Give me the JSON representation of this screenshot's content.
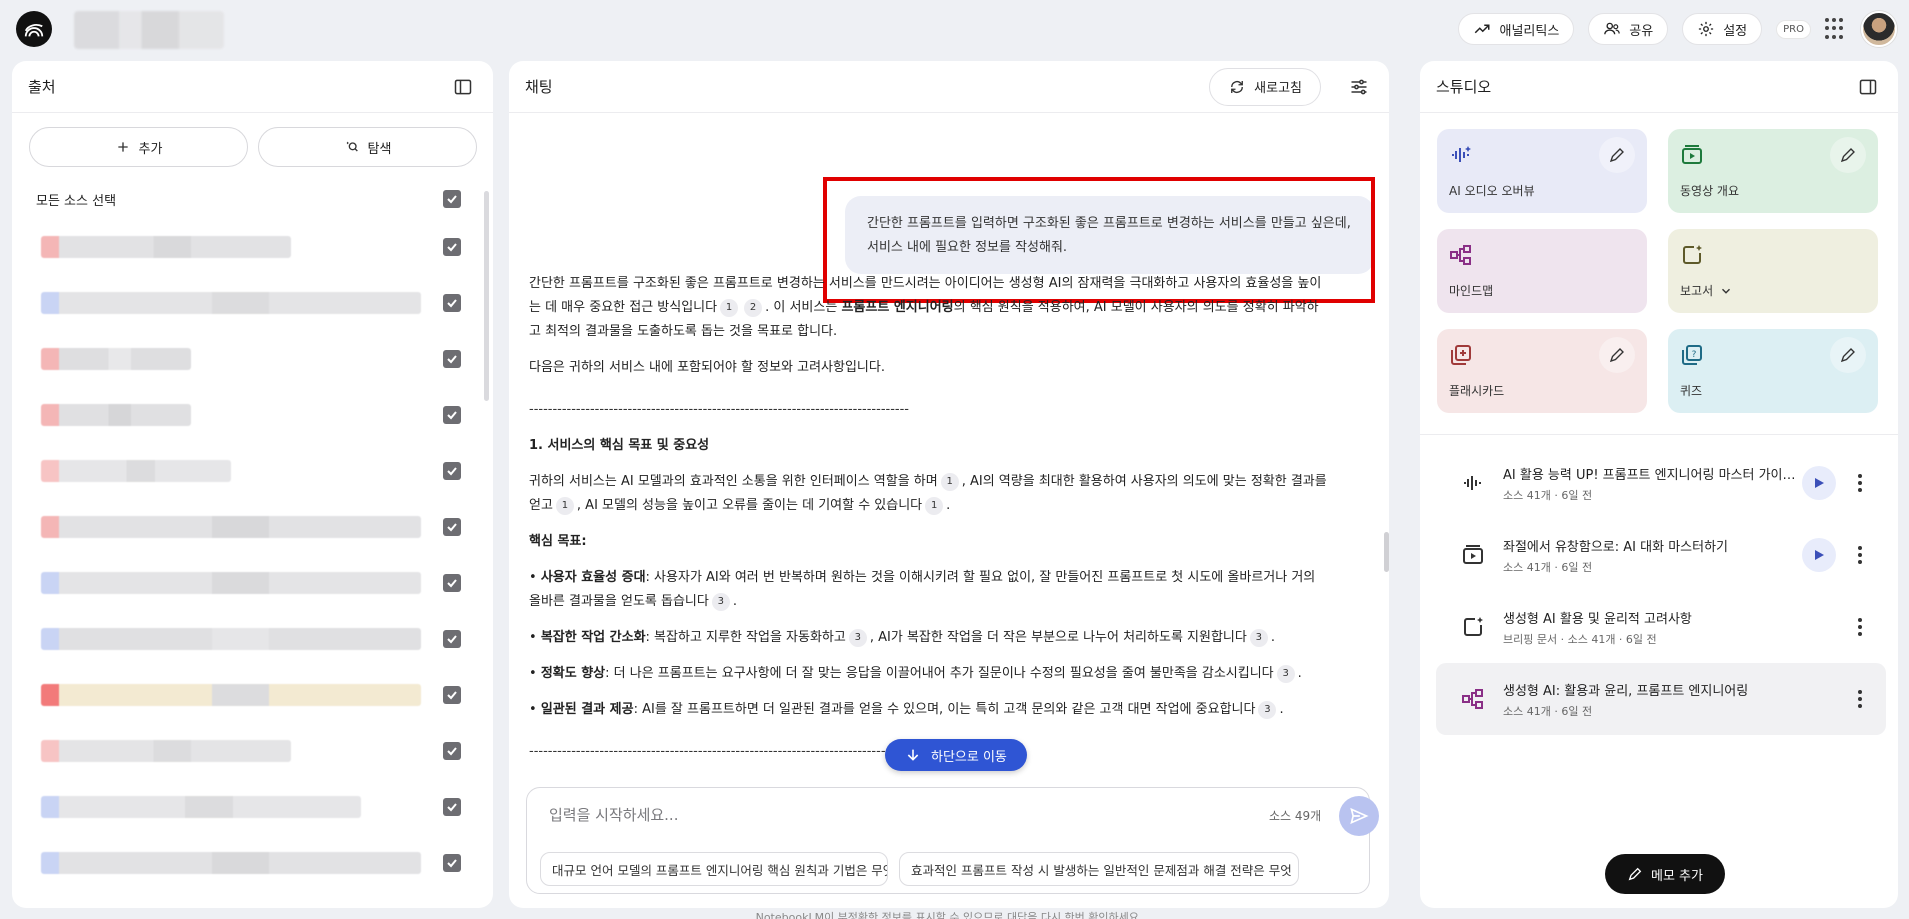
{
  "topbar": {
    "analytics": "애널리틱스",
    "share": "공유",
    "settings": "설정",
    "pro": "PRO"
  },
  "sources": {
    "title": "출처",
    "add": "추가",
    "explore": "탐색",
    "select_all": "모든 소스 선택",
    "items_count": 12
  },
  "chat": {
    "title": "채팅",
    "refresh": "새로고침",
    "user_message": "간단한 프롬프트를 입력하면 구조화된 좋은 프롬프트로 변경하는 서비스를 만들고 싶은데, 서비스 내에 필요한 정보를 작성해줘.",
    "intro_a": "간단한 프롬프트를 구조화된 좋은 프롬프트로 변경하는 서비스를 만드시려는 아이디어는 생성형 AI의 잠재력을 극대화하고 사용자의 효율성을 높이는 데 매우 중요한 접근 방식입니다",
    "intro_b": ". 이 서비스는 ",
    "intro_bold": "프롬프트 엔지니어링",
    "intro_c": "의 핵심 원칙을 적용하여, AI 모델이 사용자의 의도를 정확히 파악하고 최적의 결과물을 도출하도록 돕는 것을 목표로 합니다.",
    "intro2": "다음은 귀하의 서비스 내에 포함되어야 할 정보와 고려사항입니다.",
    "divider": "---------------------------------------------------------------------------------",
    "section1_title": "1. 서비스의 핵심 목표 및 중요성",
    "section1_a": "귀하의 서비스는 AI 모델과의 효과적인 소통을 위한 인터페이스 역할을 하며",
    "section1_b": ", AI의 역량을 최대한 활용하여 사용자의 의도에 맞는 정확한 결과를 얻고",
    "section1_c": ", AI 모델의 성능을 높이고 오류를 줄이는 데 기여할 수 있습니다",
    "goals_title": "핵심 목표:",
    "goals": [
      {
        "bold": "사용자 효율성 증대",
        "text": ": 사용자가 AI와 여러 번 반복하며 원하는 것을 이해시키려 할 필요 없이, 잘 만들어진 프롬프트로 첫 시도에 올바르거나 거의 올바른 결과물을 얻도록 돕습니다",
        "cite": "3"
      },
      {
        "bold": "복잡한 작업 간소화",
        "text": ": 복잡하고 지루한 작업을 자동화하고",
        "cite": "3",
        "text2": ", AI가 복잡한 작업을 더 작은 부분으로 나누어 처리하도록 지원합니다",
        "cite2": "3"
      },
      {
        "bold": "정확도 향상",
        "text": ": 더 나은 프롬프트는 요구사항에 더 잘 맞는 응답을 이끌어내어 추가 질문이나 수정의 필요성을 줄여 불만족을 감소시킵니다",
        "cite": "3"
      },
      {
        "bold": "일관된 결과 제공",
        "text": ": AI를 잘 프롬프트하면 더 일관된 결과를 얻을 수 있으며, 이는 특히 고객 문의와 같은 고객 대면 작업에 중요합니다",
        "cite": "3"
      }
    ],
    "cites": {
      "one": "1",
      "two": "2"
    },
    "go_bottom": "하단으로 이동",
    "input_placeholder": "입력을 시작하세요...",
    "source_count": "소스 49개",
    "suggestions": [
      "대규모 언어 모델의 프롬프트 엔지니어링 핵심 원칙과 기법은 무엇인가요?",
      "효과적인 프롬프트 작성 시 발생하는 일반적인 문제점과 해결 전략은 무엇"
    ],
    "footer_note": "NotebookLM이 부정확한 정보를 표시할 수 있으므로 대답을 다시 한번 확인하세요."
  },
  "studio": {
    "title": "스튜디오",
    "tiles": [
      {
        "label": "AI 오디오 오버뷰",
        "color": "#e8eaf7"
      },
      {
        "label": "동영상 개요",
        "color": "#dcefe1"
      },
      {
        "label": "마인드맵",
        "color": "#efe4ee"
      },
      {
        "label": "보고서",
        "color": "#efefe0"
      },
      {
        "label": "플래시카드",
        "color": "#f6e6e6"
      },
      {
        "label": "퀴즈",
        "color": "#dceff3"
      }
    ],
    "notes": [
      {
        "title": "AI 활용 능력 UP! 프롬프트 엔지니어링 마스터 가이드: 생성형 AI 제대로 쓰는 법",
        "meta": "소스 41개 · 6일 전"
      },
      {
        "title": "좌절에서 유창함으로: AI 대화 마스터하기",
        "meta": "소스 41개 · 6일 전"
      },
      {
        "title": "생성형 AI 활용 및 윤리적 고려사항",
        "meta": "브리핑 문서 · 소스 41개 · 6일 전"
      },
      {
        "title": "생성형 AI: 활용과 윤리, 프롬프트 엔지니어링",
        "meta": "소스 41개 · 6일 전"
      }
    ],
    "add_memo": "메모 추가"
  }
}
